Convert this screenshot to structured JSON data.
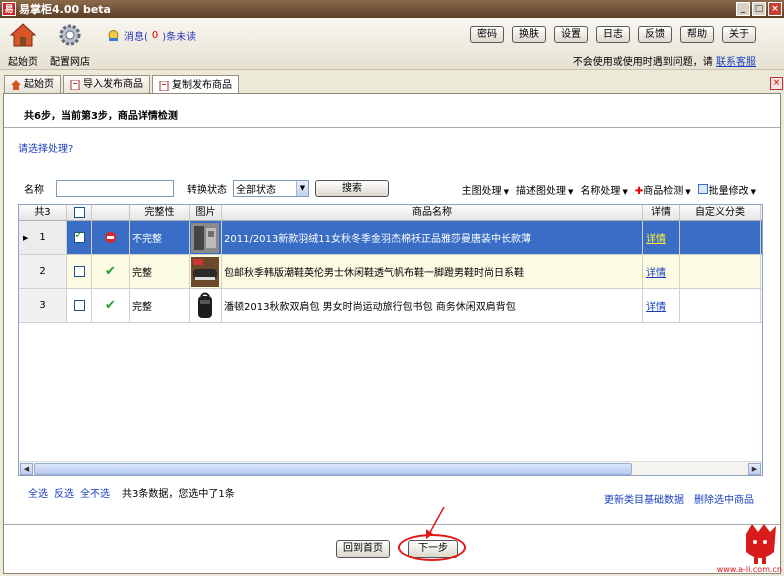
{
  "window": {
    "title": "易掌柜4.00 beta",
    "app_icon_text": "易",
    "controls": [
      "_",
      "□",
      "×"
    ]
  },
  "toolbar": {
    "home_label": "起始页",
    "config_label": "配置网店",
    "message_prefix": "消息(",
    "message_count": "0",
    "message_suffix": ")条未读",
    "buttons": [
      "密码",
      "换肤",
      "设置",
      "日志",
      "反馈",
      "帮助",
      "关于"
    ],
    "help_text": "不会使用或使用时遇到问题，请",
    "help_link": "联系客服"
  },
  "tabs": [
    {
      "label": "起始页"
    },
    {
      "label": "导入发布商品"
    },
    {
      "label": "复制发布商品"
    }
  ],
  "tab_close": "×",
  "step": {
    "title": "共6步，当前第3步，商品详情检测"
  },
  "choose_text": "请选择处理?",
  "filter": {
    "name_label": "名称",
    "name_value": "",
    "status_label": "转换状态",
    "status_value": "全部状态",
    "search_button": "搜索"
  },
  "menus": [
    {
      "label": "主图处理"
    },
    {
      "label": "描述图处理"
    },
    {
      "label": "名称处理"
    },
    {
      "label": "商品检测"
    },
    {
      "label": "批量修改"
    }
  ],
  "grid": {
    "header_count": "共3",
    "columns": [
      "完整性",
      "图片",
      "商品名称",
      "详情",
      "自定义分类"
    ],
    "rows": [
      {
        "num": "1",
        "checked": true,
        "status": "error",
        "completeness": "不完整",
        "name": "2011/2013新款羽绒11女秋冬季金羽杰棉袄正品雅莎曼唐装中长款薄",
        "detail": "详情",
        "category": ""
      },
      {
        "num": "2",
        "checked": false,
        "status": "ok",
        "completeness": "完整",
        "name": "包邮秋季韩版潮鞋英伦男士休闲鞋透气帆布鞋一脚蹬男鞋时尚日系鞋",
        "detail": "详情",
        "category": ""
      },
      {
        "num": "3",
        "checked": false,
        "status": "ok",
        "completeness": "完整",
        "name": "潘顿2013秋款双肩包 男女时尚运动旅行包书包 商务休闲双肩背包",
        "detail": "详情",
        "category": ""
      }
    ]
  },
  "bottom": {
    "select_all": "全选",
    "invert": "反选",
    "select_none": "全不选",
    "info": "共3条数据，您选中了1条",
    "update_link": "更新类目基础数据",
    "delete_link": "删除选中商品"
  },
  "nav": {
    "back_button": "回到首页",
    "next_button": "下一步"
  },
  "mascot_url": "www.a-li.com.cn",
  "colors": {
    "selected_row": "#3a6ec6",
    "link": "#1a3fbf",
    "annotation": "#e01818"
  }
}
